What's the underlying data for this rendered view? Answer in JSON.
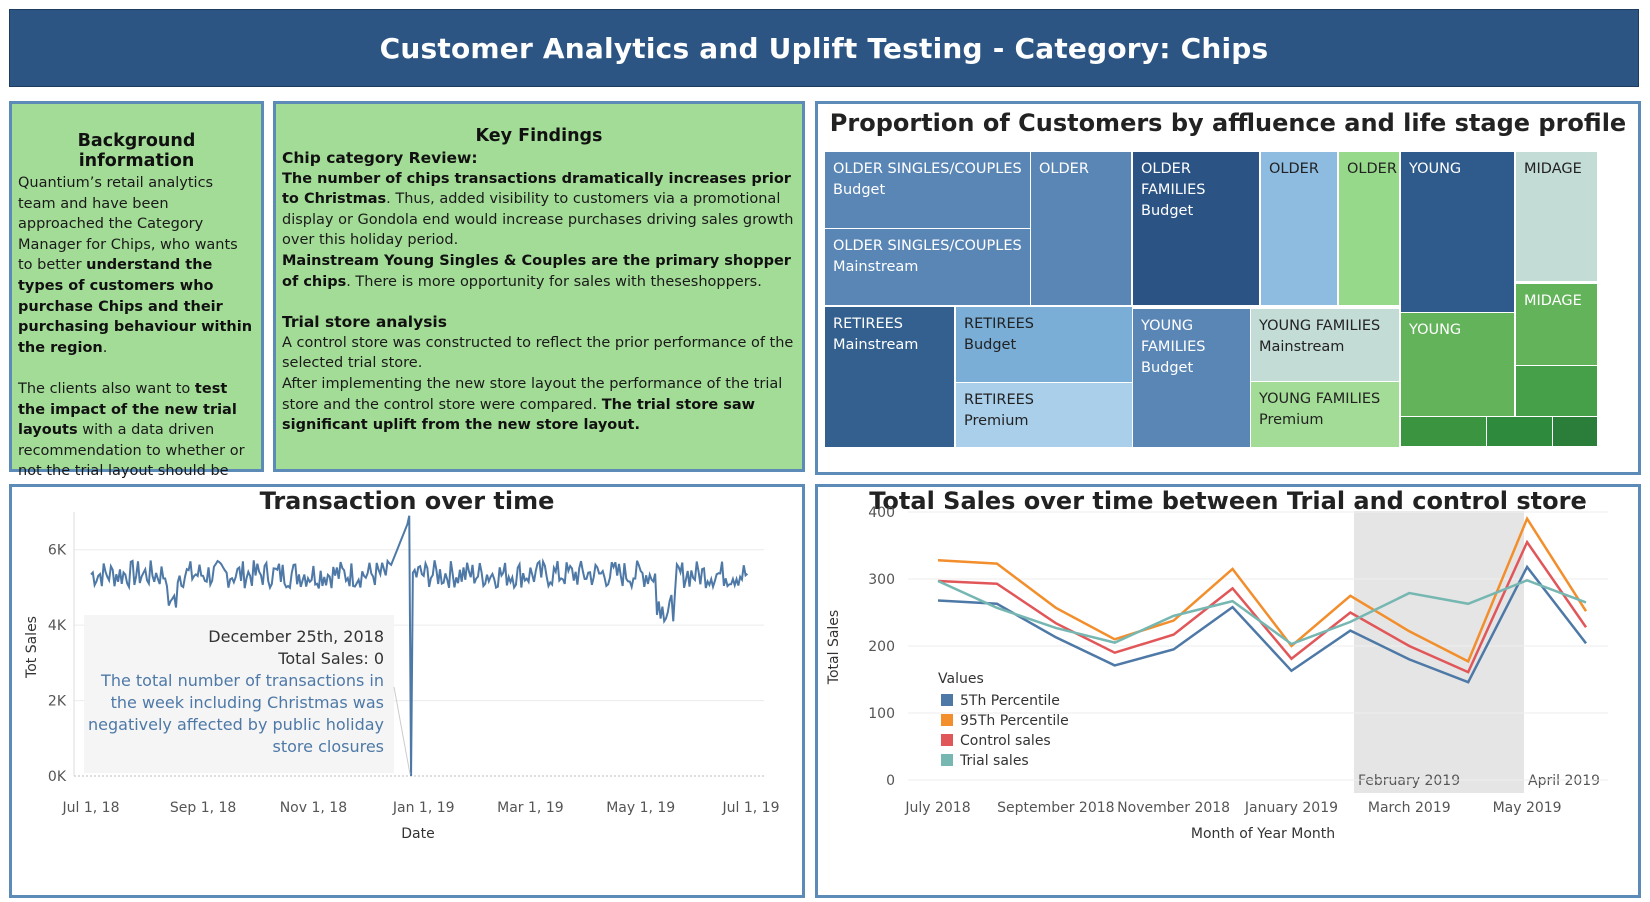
{
  "header": {
    "title": "Customer Analytics and Uplift Testing - Category: Chips"
  },
  "background": {
    "title": "Background information",
    "p1_a": "Quantium’s retail analytics team and have been approached the Category Manager for Chips, who wants to better ",
    "p1_b": "understand the types of customers who purchase Chips and their purchasing behaviour within the region",
    "p1_c": ".",
    "p2_a": "The clients also want to ",
    "p2_b": "test the impact of the new trial layouts",
    "p2_c": " with a data driven recommendation to whether or not the trial layout should be rolled out to all their stores."
  },
  "key_findings": {
    "title": "Key Findings",
    "chip_head": "Chip category Review:",
    "chip_p1_a": "The number of chips transactions dramatically increases prior to Christmas",
    "chip_p1_b": ". Thus, added visibility to customers via a promotional display or Gondola end would increase purchases driving sales growth over this holiday period.",
    "chip_p2_a": "Mainstream Young Singles & Couples are the primary shopper of chips",
    "chip_p2_b": ". There is more opportunity for sales with theseshoppers.",
    "trial_head": "Trial store analysis",
    "trial_p1": "A control store was constructed to reflect the prior performance of the selected trial store.",
    "trial_p2_a": "After implementing the new store layout the performance of the trial store and the control store were compared. ",
    "trial_p2_b": "The trial store saw significant uplift from the new store layout."
  },
  "treemap": {
    "title": "Proportion of Customers by affluence and life stage profile",
    "tiles": [
      {
        "l1": "OLDER SINGLES/COUPLES",
        "l2": "Budget",
        "color": "#5a86b5"
      },
      {
        "l1": "OLDER SINGLES/COUPLES",
        "l2": "Mainstream",
        "color": "#5a86b5"
      },
      {
        "l1": "OLDER",
        "l2": "",
        "color": "#5a86b5"
      },
      {
        "l1": "OLDER",
        "l2": "FAMILIES",
        "l3": "Budget",
        "color": "#2b5485"
      },
      {
        "l1": "OLDER",
        "l2": "",
        "color": "#8ebbe0"
      },
      {
        "l1": "OLDER",
        "l2": "",
        "color": "#97d98a"
      },
      {
        "l1": "YOUNG",
        "l2": "",
        "color": "#2e5a8c"
      },
      {
        "l1": "MIDAGE",
        "l2": "",
        "color": "#c4dcd6"
      },
      {
        "l1": "RETIREES",
        "l2": "Mainstream",
        "color": "#33608f"
      },
      {
        "l1": "RETIREES",
        "l2": "Budget",
        "color": "#7aaed7"
      },
      {
        "l1": "RETIREES",
        "l2": "Premium",
        "color": "#a9cfeb"
      },
      {
        "l1": "YOUNG",
        "l2": "FAMILIES",
        "l3": "Budget",
        "color": "#5a86b5"
      },
      {
        "l1": "YOUNG FAMILIES",
        "l2": "Mainstream",
        "color": "#c4dcd6"
      },
      {
        "l1": "YOUNG FAMILIES",
        "l2": "Premium",
        "color": "#a3dc96"
      },
      {
        "l1": "YOUNG",
        "l2": "",
        "color": "#62b35a"
      },
      {
        "l1": "MIDAGE",
        "l2": "",
        "color": "#62b35a"
      },
      {
        "l1": "",
        "l2": "",
        "color": "#45a049"
      },
      {
        "l1": "",
        "l2": "",
        "color": "#3a9440"
      },
      {
        "l1": "",
        "l2": "",
        "color": "#2e8a3c"
      },
      {
        "l1": "",
        "l2": "",
        "color": "#2a7e3a"
      },
      {
        "l1": "",
        "l2": "",
        "color": "#23703a"
      }
    ]
  },
  "transactions": {
    "title": "Transaction over time",
    "xlabel": "Date",
    "ylabel": "Tot Sales",
    "x_ticks": [
      "Jul 1, 18",
      "Sep 1, 18",
      "Nov 1, 18",
      "Jan 1, 19",
      "Mar 1, 19",
      "May 1, 19",
      "Jul 1, 19"
    ],
    "y_ticks": [
      "0K",
      "2K",
      "4K",
      "6K"
    ],
    "tooltip": {
      "date": "December 25th, 2018",
      "value": "Total Sales: 0",
      "note": "The total number of transactions in the week including Christmas was negatively affected by public holiday store closures"
    }
  },
  "sales": {
    "title": "Total Sales over time between Trial and control store",
    "xlabel": "Month of Year Month",
    "ylabel": "Total Sales",
    "x_ticks": [
      "July 2018",
      "September 2018",
      "November 2018",
      "January 2019",
      "March 2019",
      "May 2019"
    ],
    "y_ticks": [
      "0",
      "100",
      "200",
      "300",
      "400"
    ],
    "band_start_label": "February 2019",
    "band_end_label": "April 2019",
    "legend_title": "Values",
    "legend": [
      {
        "name": "5Th Percentile",
        "color": "#4e79a7"
      },
      {
        "name": "95Th Percentile",
        "color": "#f28e2b"
      },
      {
        "name": "Control sales",
        "color": "#e15759"
      },
      {
        "name": "Trial sales",
        "color": "#76b7b2"
      }
    ]
  },
  "chart_data": [
    {
      "type": "line",
      "title": "Transaction over time",
      "xlabel": "Date",
      "ylabel": "Tot Sales",
      "ylim": [
        0,
        7000
      ],
      "x_range": [
        "2018-07-01",
        "2019-06-30"
      ],
      "series": [
        {
          "name": "Tot Sales",
          "color": "#4e79a7",
          "daily_values_summary": "daily values mostly between 5000 and 5800",
          "notable_points": [
            {
              "x": "2018-08-15",
              "y": 4400
            },
            {
              "x": "2018-12-24",
              "y": 6900
            },
            {
              "x": "2018-12-25",
              "y": 0
            },
            {
              "x": "2019-05-15",
              "y": 4100
            }
          ]
        }
      ]
    },
    {
      "type": "line",
      "title": "Total Sales over time between Trial and control store",
      "xlabel": "Month of Year Month",
      "ylabel": "Total Sales",
      "ylim": [
        0,
        400
      ],
      "highlight": [
        "February 2019",
        "April 2019"
      ],
      "x": [
        "2018-07",
        "2018-08",
        "2018-09",
        "2018-10",
        "2018-11",
        "2018-12",
        "2019-01",
        "2019-02",
        "2019-03",
        "2019-04",
        "2019-05",
        "2019-06"
      ],
      "series": [
        {
          "name": "5Th Percentile",
          "color": "#4e79a7",
          "values": [
            268,
            263,
            213,
            171,
            195,
            258,
            163,
            223,
            180,
            146,
            318,
            204
          ]
        },
        {
          "name": "95Th Percentile",
          "color": "#f28e2b",
          "values": [
            328,
            323,
            257,
            210,
            238,
            315,
            200,
            275,
            222,
            177,
            390,
            252
          ]
        },
        {
          "name": "Control sales",
          "color": "#e15759",
          "values": [
            297,
            293,
            234,
            190,
            217,
            286,
            181,
            250,
            200,
            161,
            355,
            228
          ]
        },
        {
          "name": "Trial sales",
          "color": "#76b7b2",
          "values": [
            297,
            257,
            227,
            205,
            245,
            267,
            203,
            236,
            279,
            263,
            298,
            265
          ]
        }
      ]
    }
  ]
}
